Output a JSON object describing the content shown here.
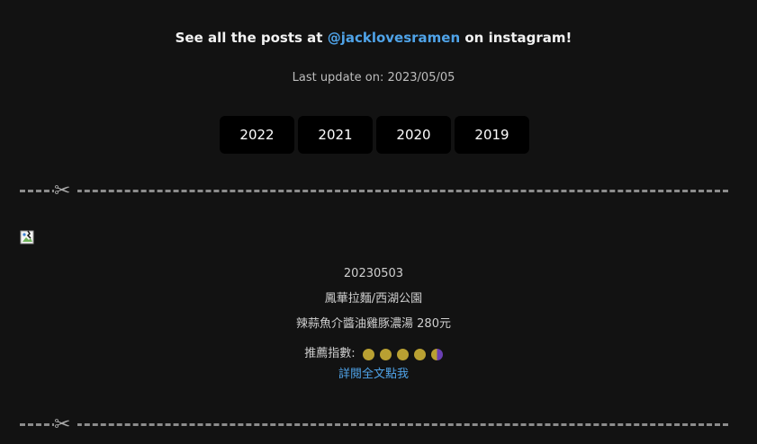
{
  "header": {
    "prefix": "See all the posts at ",
    "handle": "@jacklovesramen",
    "suffix": " on instagram!",
    "last_update_label": "Last update on: 2023/05/05"
  },
  "year_tabs": [
    "2022",
    "2021",
    "2020",
    "2019"
  ],
  "post": {
    "date": "20230503",
    "shop": "鳳華拉麵/西湖公園",
    "dish": "辣蒜魚介醬油雞豚濃湯 280元",
    "rating_label": "推薦指數:",
    "rating": 4.5,
    "rating_max": 5,
    "read_more": "詳閱全文點我"
  },
  "icons": {
    "divider": "scissors-icon",
    "image": "broken-image-icon"
  },
  "colors": {
    "background": "#121212",
    "link": "#4fa3e8",
    "rating_full": "#b9a032",
    "rating_half": "#6a3fb3"
  }
}
